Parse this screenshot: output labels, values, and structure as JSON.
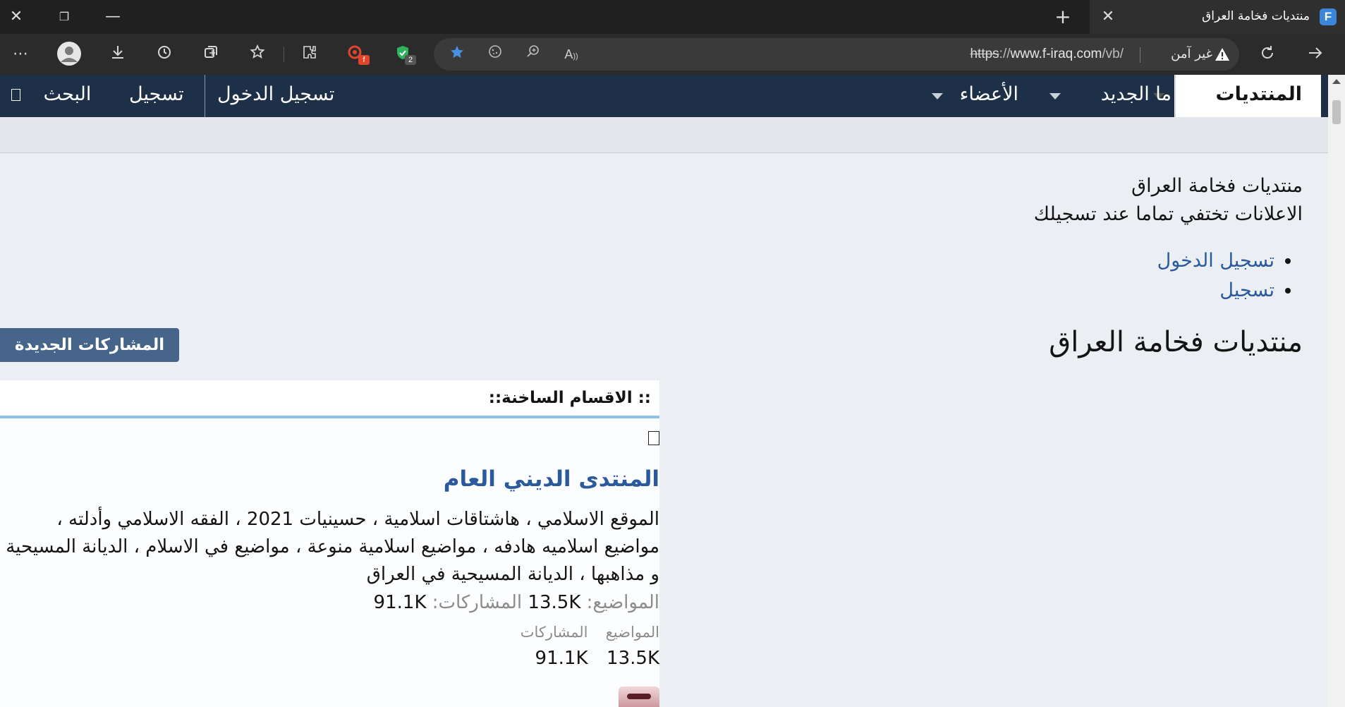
{
  "browser": {
    "tab": {
      "title": "منتديات فخامة العراق",
      "favicon_letter": "F"
    },
    "address": {
      "scheme": "https",
      "separator": "://",
      "host": "www.f-iraq.com",
      "path": "/vb/",
      "security_label": "غير آمن"
    },
    "extensions": [
      {
        "name": "cherry-ext",
        "badge": "f",
        "badge_color": "#e0442b"
      },
      {
        "name": "shield-ext",
        "badge": "2",
        "badge_color": "#555555"
      }
    ]
  },
  "nav": {
    "forums": "المنتديات",
    "whats_new": "ما الجديد",
    "members": "الأعضاء",
    "login": "تسجيل الدخول",
    "register": "تسجيل",
    "search": "البحث"
  },
  "notice": {
    "site_name": "منتديات فخامة العراق",
    "ad_note": "الاعلانات تختفي تماما عند تسجيلك",
    "links": [
      "تسجيل الدخول",
      "تسجيل"
    ]
  },
  "page": {
    "title": "منتديات فخامة العراق",
    "new_posts_button": "المشاركات الجديدة"
  },
  "block": {
    "header": ":: الاقسام الساخنة::",
    "forum": {
      "title": "المنتدى الديني العام",
      "description": "الموقع الاسلامي ، هاشتاقات اسلامية ، حسينيات 2021 ، الفقه الاسلامي وأدلته ، مواضيع اسلاميه هادفه ، مواضيع اسلامية منوعة ، مواضيع في الاسلام ، الديانة المسيحية و مذاهبها ، الديانة المسيحية في العراق",
      "threads_label": "المواضيع:",
      "threads_value": "13.5K",
      "posts_label": "المشاركات:",
      "posts_value": "91.1K",
      "col_threads": "المواضيع",
      "col_posts": "المشاركات"
    }
  },
  "colors": {
    "nav_bg": "#1d3048",
    "link": "#2a5a9c",
    "button": "#47658b",
    "header_rule": "#8cc2ea"
  }
}
